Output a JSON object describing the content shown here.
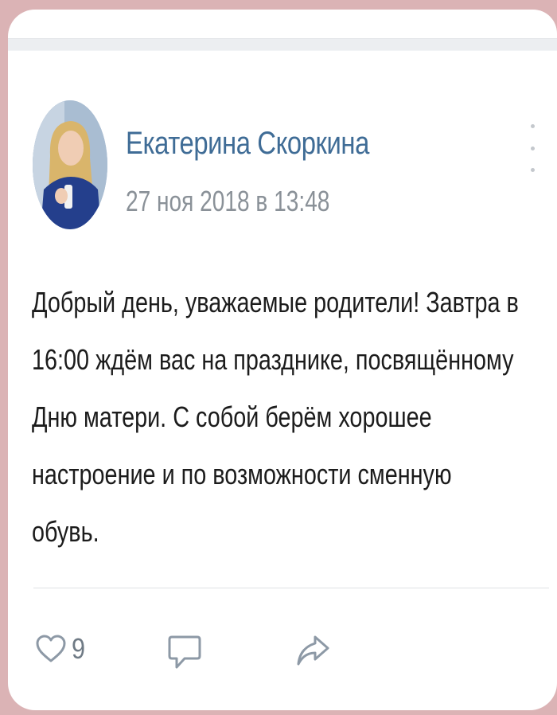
{
  "post": {
    "author": "Екатерина Скоркина",
    "date": "27 ноя 2018 в 13:48",
    "text_lines": [
      "Добрый день, уважаемые родители! Завтра в",
      "16:00 ждём вас на празднике, посвящённому",
      "Дню матери. С собой берём хорошее",
      "настроение и по возможности сменную",
      "обувь."
    ],
    "likes": "9"
  },
  "icons": {
    "menu": "more-vertical-icon",
    "like": "heart-outline-icon",
    "comment": "comment-bubble-icon",
    "share": "share-arrow-icon"
  },
  "colors": {
    "author": "#3f6c96",
    "date": "#8a9198",
    "icon": "#8d99a6",
    "background": "#dbb3b5"
  }
}
